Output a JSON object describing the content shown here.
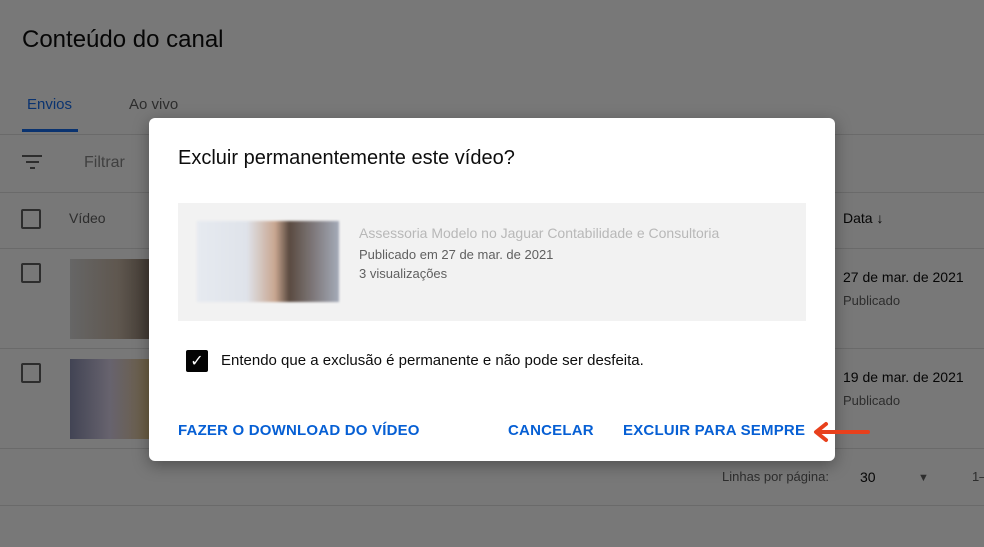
{
  "page": {
    "title": "Conteúdo do canal",
    "tabs": [
      {
        "label": "Envios",
        "active": true
      },
      {
        "label": "Ao vivo",
        "active": false
      }
    ],
    "filter_placeholder": "Filtrar",
    "table": {
      "headers": {
        "video": "Vídeo",
        "date": "Data"
      },
      "rows": [
        {
          "date": "27 de mar. de 2021",
          "status": "Publicado"
        },
        {
          "date": "19 de mar. de 2021",
          "status": "Publicado"
        }
      ]
    },
    "pagination": {
      "rows_per_page_label": "Linhas por página:",
      "rows_per_page": "30",
      "range": "1–"
    }
  },
  "dialog": {
    "title": "Excluir permanentemente este vídeo?",
    "video": {
      "title": "Assessoria Modelo no Jaguar Contabilidade e Consultoria",
      "published": "Publicado em 27 de mar. de 2021",
      "views": "3 visualizações"
    },
    "confirm_label": "Entendo que a exclusão é permanente e não pode ser desfeita.",
    "confirm_checked": true,
    "download_label": "FAZER O DOWNLOAD DO VÍDEO",
    "cancel_label": "CANCELAR",
    "delete_label": "EXCLUIR PARA SEMPRE"
  },
  "colors": {
    "accent": "#065fd4",
    "annotation_arrow": "#e8401c"
  }
}
